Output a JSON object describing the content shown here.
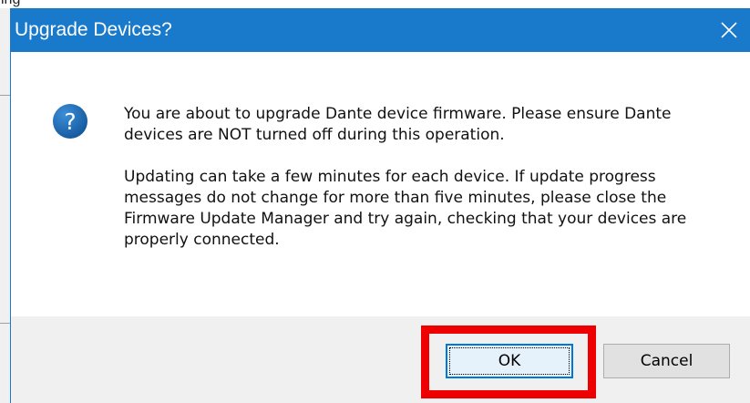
{
  "background_window": {
    "partial_text": "ing"
  },
  "dialog": {
    "title": "Upgrade Devices?",
    "close_icon": "close-icon",
    "icon": "question-icon",
    "icon_glyph": "?",
    "message": {
      "paragraph1": "You are about to upgrade Dante device firmware. Please ensure Dante devices are NOT turned off during this operation.",
      "paragraph2": "Updating can take a few minutes for each device. If update progress messages do not change for more than five minutes, please close the Firmware Update Manager and try again, checking that your devices are properly connected."
    },
    "buttons": {
      "ok_label": "OK",
      "cancel_label": "Cancel"
    }
  },
  "colors": {
    "titlebar": "#1979ca",
    "icon": "#1f6fb8",
    "highlight": "#ee0000",
    "footer": "#f0f0f0"
  }
}
